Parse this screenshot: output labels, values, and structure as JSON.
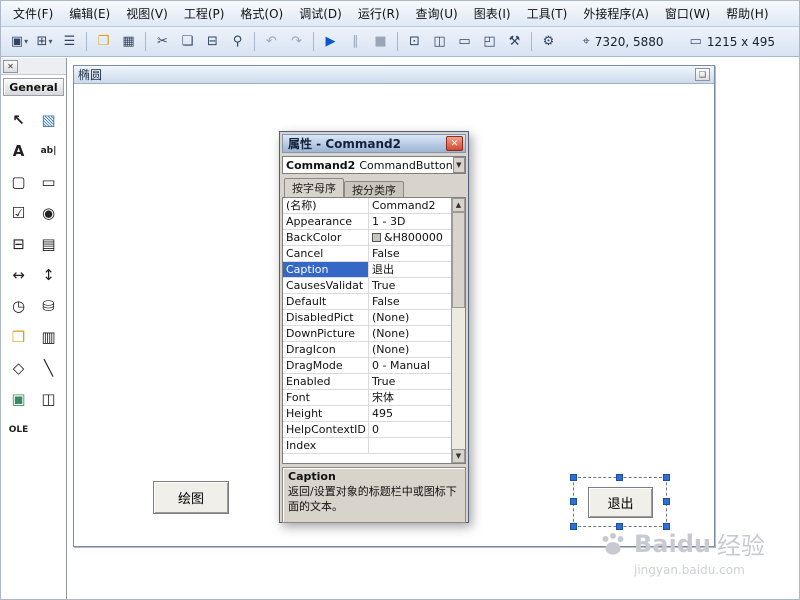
{
  "menubar": {
    "items": [
      "文件(F)",
      "编辑(E)",
      "视图(V)",
      "工程(P)",
      "格式(O)",
      "调试(D)",
      "运行(R)",
      "查询(U)",
      "图表(I)",
      "工具(T)",
      "外接程序(A)",
      "窗口(W)",
      "帮助(H)"
    ]
  },
  "toolbar": {
    "icons": {
      "add_project": "▣",
      "add_form": "⊞",
      "menu_editor": "☰",
      "open_project": "❐",
      "save_project": "▦",
      "cut": "✂",
      "copy": "❏",
      "paste": "⊟",
      "find": "⚲",
      "undo": "↶",
      "redo": "↷",
      "start": "▶",
      "break": "∥",
      "end": "■",
      "project_explorer": "⊡",
      "properties_window": "◫",
      "form_layout": "▭",
      "object_browser": "◰",
      "toolbox": "⚒",
      "data_view": "⛁",
      "component": "⚙",
      "dropdown_arrow": "▾",
      "position_icon": "⌖",
      "size_icon": "▭"
    },
    "position_value": "7320, 5880",
    "size_value": "1215 x 495"
  },
  "toolbox": {
    "close_glyph": "✕",
    "tab_label": "General",
    "items": [
      {
        "name": "pointer",
        "glyph": "↖"
      },
      {
        "name": "picturebox",
        "glyph": "▧"
      },
      {
        "name": "label",
        "glyph": "A"
      },
      {
        "name": "textbox",
        "glyph": "ab|"
      },
      {
        "name": "frame",
        "glyph": "▢"
      },
      {
        "name": "commandbutton",
        "glyph": "▭"
      },
      {
        "name": "checkbox",
        "glyph": "☑"
      },
      {
        "name": "optionbutton",
        "glyph": "◉"
      },
      {
        "name": "combobox",
        "glyph": "⊟"
      },
      {
        "name": "listbox",
        "glyph": "▤"
      },
      {
        "name": "hscrollbar",
        "glyph": "↔"
      },
      {
        "name": "vscrollbar",
        "glyph": "↕"
      },
      {
        "name": "timer",
        "glyph": "◷"
      },
      {
        "name": "drivelistbox",
        "glyph": "⛁"
      },
      {
        "name": "dirlistbox",
        "glyph": "❒"
      },
      {
        "name": "filelistbox",
        "glyph": "▥"
      },
      {
        "name": "shape",
        "glyph": "◇"
      },
      {
        "name": "line",
        "glyph": "╲"
      },
      {
        "name": "image",
        "glyph": "▣"
      },
      {
        "name": "data",
        "glyph": "◫"
      },
      {
        "name": "ole",
        "glyph": "OLE"
      }
    ]
  },
  "form_window": {
    "title": "椭圆",
    "window_button_glyph": "❑",
    "draw_button": "绘图",
    "exit_button": "退出"
  },
  "properties": {
    "title": "属性 - Command2",
    "close_glyph": "✕",
    "object_name": "Command2",
    "object_class": "CommandButton",
    "dropdown_arrow": "▼",
    "tabs": [
      "按字母序",
      "按分类序"
    ],
    "rows": [
      {
        "n": "(名称)",
        "v": "Command2"
      },
      {
        "n": "Appearance",
        "v": "1 - 3D"
      },
      {
        "n": "BackColor",
        "v": "&H800000"
      },
      {
        "n": "Cancel",
        "v": "False"
      },
      {
        "n": "Caption",
        "v": "退出"
      },
      {
        "n": "CausesValidat",
        "v": "True"
      },
      {
        "n": "Default",
        "v": "False"
      },
      {
        "n": "DisabledPict",
        "v": "(None)"
      },
      {
        "n": "DownPicture",
        "v": "(None)"
      },
      {
        "n": "DragIcon",
        "v": "(None)"
      },
      {
        "n": "DragMode",
        "v": "0 - Manual"
      },
      {
        "n": "Enabled",
        "v": "True"
      },
      {
        "n": "Font",
        "v": "宋体"
      },
      {
        "n": "Height",
        "v": "495"
      },
      {
        "n": "HelpContextID",
        "v": "0"
      },
      {
        "n": "Index",
        "v": ""
      }
    ],
    "scroll_up": "▲",
    "scroll_down": "▼",
    "description_title": "Caption",
    "description_text": "返回/设置对象的标题栏中或图标下面的文本。"
  },
  "watermark": {
    "brand": "Baidu",
    "suffix": "经验",
    "domain": "jingyan.baidu.com"
  },
  "colors": {
    "accent_blue": "#0b57c9",
    "selection_handle": "#2f6fd0",
    "property_highlight": "#3567c6",
    "close_red": "#d6482f",
    "folder_yellow": "#d8a21a",
    "image_green": "#3a8a5f",
    "picture_blue": "#3a74a8"
  }
}
